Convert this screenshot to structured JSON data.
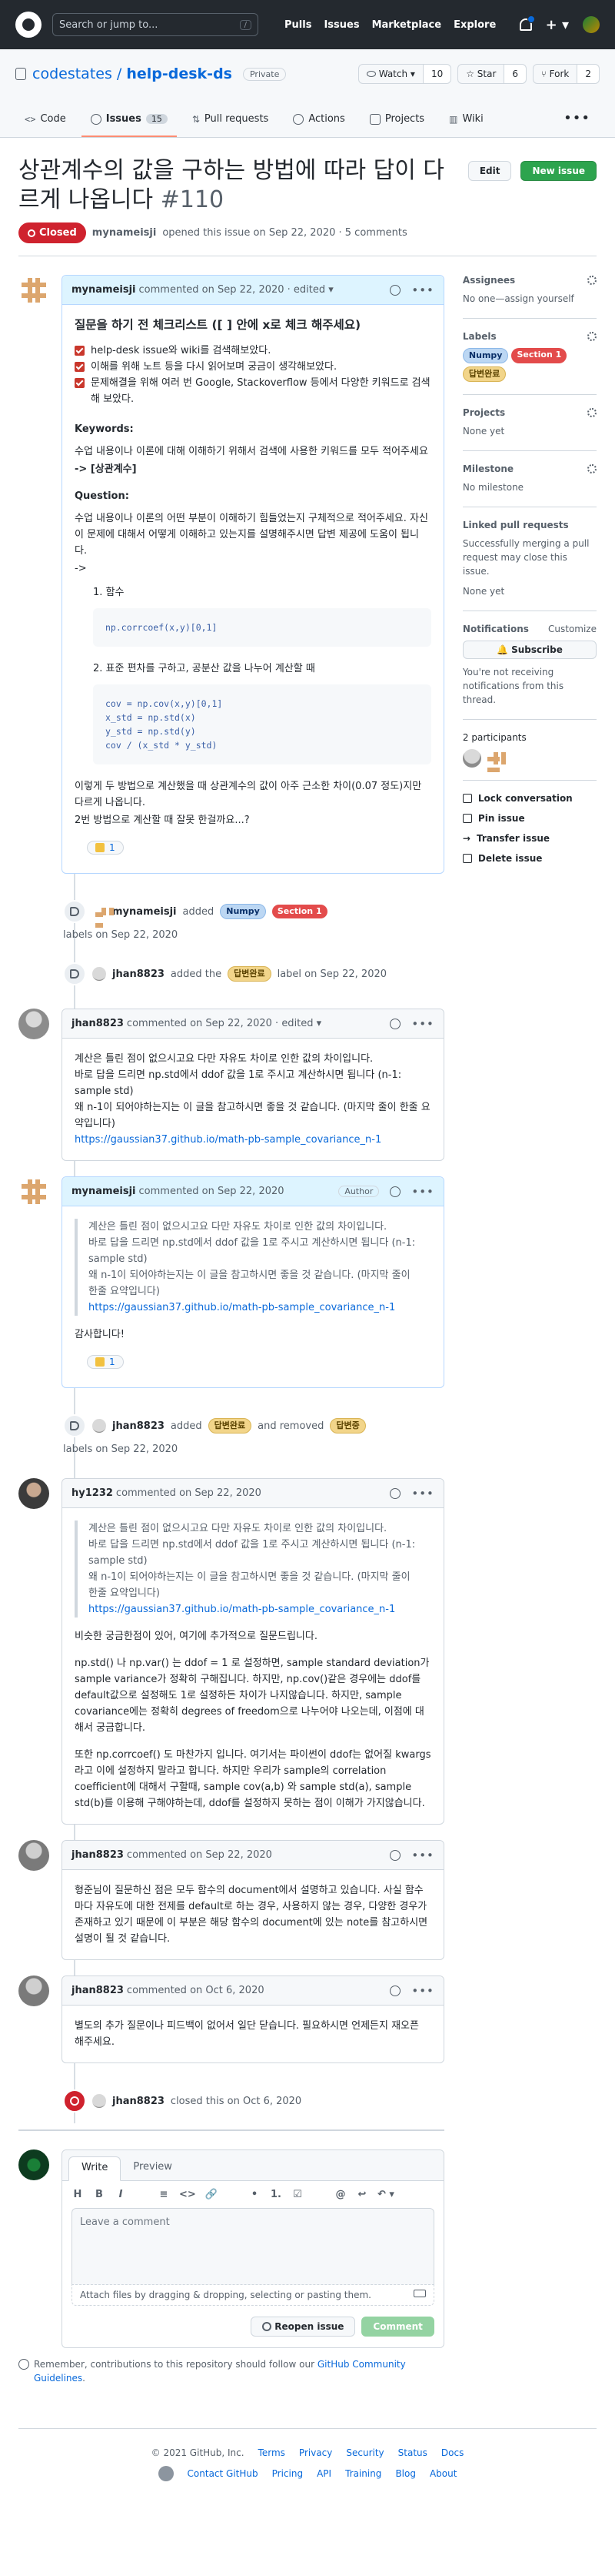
{
  "topbar": {
    "search_placeholder": "Search or jump to...",
    "search_key": "/",
    "nav": [
      "Pulls",
      "Issues",
      "Marketplace",
      "Explore"
    ],
    "plus": "+ ▾"
  },
  "repo": {
    "owner": "codestates",
    "name": "help-desk-ds",
    "separator": " / ",
    "visibility": "Private",
    "watch_label": "Watch ▾",
    "watch_count": "10",
    "star_label": "☆ Star",
    "star_count": "6",
    "fork_label": "Fork",
    "fork_count": "2",
    "tabs": [
      {
        "label": "Code"
      },
      {
        "label": "Issues",
        "count": "15"
      },
      {
        "label": "Pull requests"
      },
      {
        "label": "Actions"
      },
      {
        "label": "Projects"
      },
      {
        "label": "Wiki"
      }
    ],
    "more": "•••"
  },
  "issue": {
    "title": "상관계수의 값을 구하는 방법에 따라 답이 다르게 나옵니다",
    "number": "#110",
    "edit_label": "Edit",
    "new_label": "New issue",
    "state": "Closed",
    "author": "mynameisji",
    "opened_text": "opened this issue on Sep 22, 2020 · 5 comments"
  },
  "comments": {
    "c1": {
      "author": "mynameisji",
      "meta": "commented on Sep 22, 2020 · edited ▾",
      "heading": "질문을 하기 전 체크리스트 ([ ] 안에 x로 체크 해주세요)",
      "tasks": [
        "help-desk issue와 wiki를 검색해보았다.",
        "이해를 위해 노트 등을 다시 읽어보며 궁금이 생각해보았다.",
        "문제해결을 위해 여러 번 Google, Stackoverflow 등에서 다양한 키워드로 검색해 보았다."
      ],
      "kw_title": "Keywords:",
      "kw_text": "수업 내용이나 이론에 대해 이해하기 위해서 검색에 사용한 키워드를 모두 적어주세요",
      "kw_value": "-> [상관계수]",
      "q_title": "Question:",
      "q_text": "수업 내용이나 이론의 어떤 부분이 이해하기 힘들었는지 구체적으로 적어주세요. 자신이 문제에 대해서 어떻게 이해하고 있는지를 설명해주시면 답변 제공에 도움이 됩니다.",
      "q_arrow": "->",
      "step1": "1. 함수",
      "code1": "np.corrcoef(x,y)[0,1]",
      "step2": "2. 표준 편차를 구하고, 공분산 값을 나누어 계산할 때",
      "code2": "cov = np.cov(x,y)[0,1]\nx_std = np.std(x)\ny_std = np.std(y)\ncov / (x_std * y_std)",
      "closing": "이렇게 두 방법으로 계산했을 때 상관계수의 값이 아주 근소한 차이(0.07 정도)지만 다르게 나옵니다.",
      "closing2": "2번 방법으로 계산할 때 잘못 한걸까요...?",
      "reaction": "1"
    },
    "e1": {
      "actor": "mynameisji",
      "action": "added",
      "labels": [
        "Numpy",
        "Section 1"
      ],
      "tail": "labels on Sep 22, 2020"
    },
    "e2": {
      "actor": "jhan8823",
      "action": "added the",
      "labels": [
        "답변완료"
      ],
      "tail": "label on Sep 22, 2020"
    },
    "c2": {
      "author": "jhan8823",
      "meta": "commented on Sep 22, 2020 · edited ▾",
      "l1": "계산은 틀린 점이 없으시고요 다만 자유도 차이로 인한 값의 차이입니다.",
      "l2": "바로 답을 드리면 np.std에서 ddof 값을 1로 주시고 계산하시면 됩니다 (n-1: sample std)",
      "l3": "왜 n-1이 되어야하는지는 이 글을 참고하시면 좋을 것 같습니다. (마지막 줄이 한줄 요약입니다)",
      "link": "https://gaussian37.github.io/math-pb-sample_covariance_n-1"
    },
    "c3": {
      "author": "mynameisji",
      "meta": "commented on Sep 22, 2020",
      "role": "Author",
      "q1": "계산은 틀린 점이 없으시고요 다만 자유도 차이로 인한 값의 차이입니다.",
      "q2": "바로 답을 드리면 np.std에서 ddof 값을 1로 주시고 계산하시면 됩니다 (n-1: sample std)",
      "q3": "왜 n-1이 되어야하는지는 이 글을 참고하시면 좋을 것 같습니다. (마지막 줄이 한줄 요약입니다)",
      "qlink": "https://gaussian37.github.io/math-pb-sample_covariance_n-1",
      "text": "감사합니다!",
      "reaction": "1"
    },
    "e3": {
      "actor": "jhan8823",
      "action": "added",
      "label_a": "답변완료",
      "mid": "and removed",
      "label_b": "답변중",
      "tail": "labels on Sep 22, 2020"
    },
    "c4": {
      "author": "hy1232",
      "meta": "commented on Sep 22, 2020",
      "q1": "계산은 틀린 점이 없으시고요 다만 자유도 차이로 인한 값의 차이입니다.",
      "q2": "바로 답을 드리면 np.std에서 ddof 값을 1로 주시고 계산하시면 됩니다 (n-1: sample std)",
      "q3": "왜 n-1이 되어야하는지는 이 글을 참고하시면 좋을 것 같습니다. (마지막 줄이 한줄 요약입니다)",
      "qlink": "https://gaussian37.github.io/math-pb-sample_covariance_n-1",
      "p1": "비슷한 궁금한점이 있어, 여기에 추가적으로 질문드립니다.",
      "p2": "np.std() 나 np.var() 는 ddof = 1 로 설정하면, sample standard deviation가 sample variance가 정확히 구해집니다. 하지만, np.cov()같은 경우에는 ddof를 default값으로 설정해도 1로 설정하든 차이가 나지않습니다. 하지만, sample covariance에는 정확히 degrees of freedom으로 나누어야 나오는데, 이점에 대해서 궁금합니다.",
      "p3": "또한 np.corrcoef() 도 마찬가지 입니다. 여기서는 파이썬이 ddof는 없어질 kwargs라고 이에 설정하지 말라고 합니다. 하지만 우리가 sample의 correlation coefficient에 대해서 구할때, sample cov(a,b) 와 sample std(a), sample std(b)를 이용해 구해야하는데, ddof를 설정하지 못하는 점이 이해가 가지않습니다."
    },
    "c5": {
      "author": "jhan8823",
      "meta": "commented on Sep 22, 2020",
      "text": "형준님이 질문하신 점은 모두 함수의 document에서 설명하고 있습니다. 사실 함수마다 자유도에 대한 전제를 default로 하는 경우, 사용하지 않는 경우, 다양한 경우가 존재하고 있기 때문에 이 부분은 해당 함수의 document에 있는 note를 참고하시면 설명이 될 것 같습니다."
    },
    "c6": {
      "author": "jhan8823",
      "meta": "commented on Oct 6, 2020",
      "text": "별도의 추가 질문이나 피드백이 없어서 일단 닫습니다. 필요하시면 언제든지 재오픈 해주세요."
    },
    "e4": {
      "actor": "jhan8823",
      "tail": "closed this on Oct 6, 2020"
    }
  },
  "composer": {
    "tab_write": "Write",
    "tab_preview": "Preview",
    "tools": [
      "H",
      "B",
      "I",
      "≡",
      "<>",
      "🔗",
      "•",
      "1.",
      "☑",
      "@",
      "↩",
      "↶ ▾"
    ],
    "placeholder": "Leave a comment",
    "attach": "Attach files by dragging & dropping, selecting or pasting them.",
    "reopen": "Reopen issue",
    "comment": "Comment",
    "remember_pre": "Remember, contributions to this repository should follow our",
    "remember_link": "GitHub Community Guidelines",
    "remember_post": "."
  },
  "sidebar": {
    "assignees_title": "Assignees",
    "assignees_text": "No one—assign yourself",
    "labels_title": "Labels",
    "labels": [
      "Numpy",
      "Section 1",
      "답변완료"
    ],
    "projects_title": "Projects",
    "projects_text": "None yet",
    "milestone_title": "Milestone",
    "milestone_text": "No milestone",
    "linked_title": "Linked pull requests",
    "linked_text": "Successfully merging a pull request may close this issue.",
    "linked_none": "None yet",
    "notif_title": "Notifications",
    "notif_customize": "Customize",
    "subscribe": "🔔 Subscribe",
    "notif_text": "You're not receiving notifications from this thread.",
    "participants_title": "2 participants",
    "actions": [
      "Lock conversation",
      "Pin issue",
      "Transfer issue",
      "Delete issue"
    ]
  },
  "footer": {
    "copyright": "© 2021 GitHub, Inc.",
    "row1": [
      "Terms",
      "Privacy",
      "Security",
      "Status",
      "Docs"
    ],
    "row2": [
      "Contact GitHub",
      "Pricing",
      "API",
      "Training",
      "Blog",
      "About"
    ]
  }
}
